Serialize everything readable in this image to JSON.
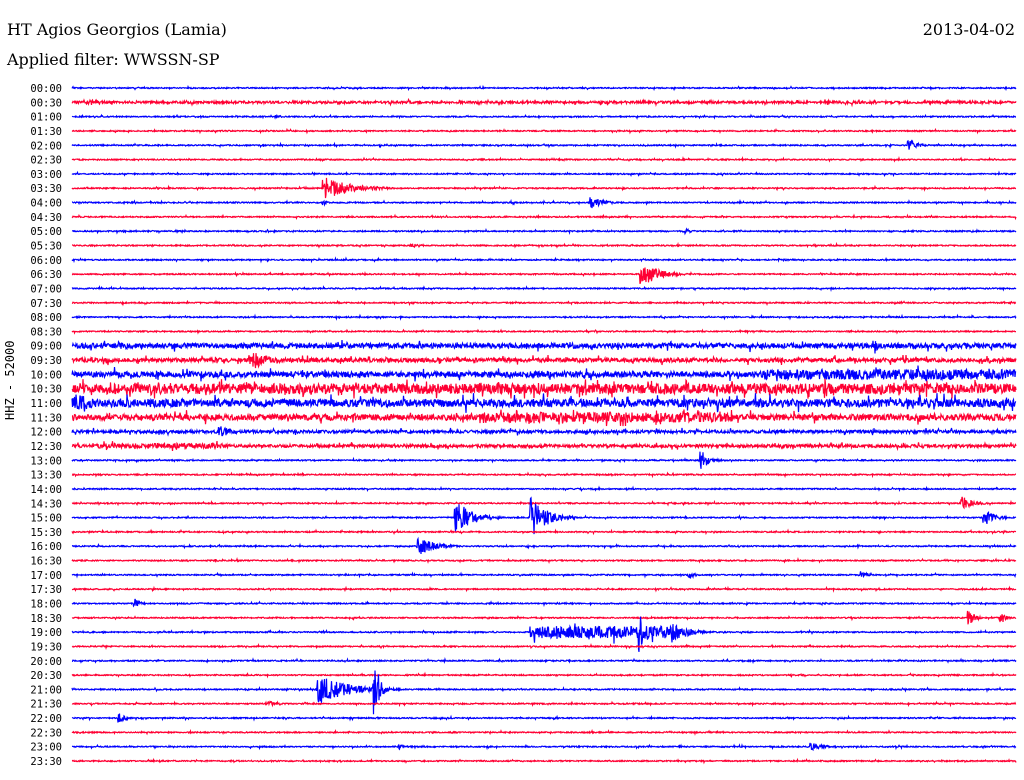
{
  "header": {
    "station": "HT Agios Georgios (Lamia)",
    "filter": "Applied filter: WWSSN-SP",
    "date": "2013-04-02"
  },
  "chart_data": {
    "type": "line",
    "title": "HT Agios Georgios (Lamia)",
    "ylabel": "HHZ - 52000",
    "xlabel": "",
    "minutes_per_row": 30,
    "colors": {
      "even": "#0000ff",
      "odd": "#ff0033"
    },
    "row_labels": [
      "00:00",
      "00:30",
      "01:00",
      "01:30",
      "02:00",
      "02:30",
      "03:00",
      "03:30",
      "04:00",
      "04:30",
      "05:00",
      "05:30",
      "06:00",
      "06:30",
      "07:00",
      "07:30",
      "08:00",
      "08:30",
      "09:00",
      "09:30",
      "10:00",
      "10:30",
      "11:00",
      "11:30",
      "12:00",
      "12:30",
      "13:00",
      "13:30",
      "14:00",
      "14:30",
      "15:00",
      "15:30",
      "16:00",
      "16:30",
      "17:00",
      "17:30",
      "18:00",
      "18:30",
      "19:00",
      "19:30",
      "20:00",
      "20:30",
      "21:00",
      "21:30",
      "22:00",
      "22:30",
      "23:00",
      "23:30"
    ],
    "noise_levels": {
      "18": 2.5,
      "19": 2,
      "20": 3,
      "21": 4,
      "22": 4,
      "23": 3,
      "24": 1.5,
      "25": 1.5,
      "1": 1.2
    },
    "events": [
      {
        "row": 1,
        "minute": 0.5,
        "amp": 3,
        "dur": 3
      },
      {
        "row": 2,
        "minute": 6.5,
        "amp": 2,
        "dur": 0.6
      },
      {
        "row": 4,
        "minute": 26.6,
        "amp": 6,
        "dur": 0.8
      },
      {
        "row": 7,
        "minute": 8.0,
        "amp": 12,
        "dur": 2.5
      },
      {
        "row": 8,
        "minute": 8.0,
        "amp": 3,
        "dur": 0.3
      },
      {
        "row": 8,
        "minute": 16.5,
        "amp": 6,
        "dur": 1.2
      },
      {
        "row": 10,
        "minute": 19.5,
        "amp": 3,
        "dur": 0.6
      },
      {
        "row": 11,
        "minute": 10.8,
        "amp": 2,
        "dur": 1.5
      },
      {
        "row": 12,
        "minute": 22.5,
        "amp": 2,
        "dur": 0.8
      },
      {
        "row": 13,
        "minute": 18.1,
        "amp": 14,
        "dur": 1.5
      },
      {
        "row": 18,
        "minute": 1.5,
        "amp": 4,
        "dur": 3
      },
      {
        "row": 18,
        "minute": 25.5,
        "amp": 10,
        "dur": 0.4
      },
      {
        "row": 19,
        "minute": 5.7,
        "amp": 10,
        "dur": 2
      },
      {
        "row": 19,
        "minute": 8.5,
        "amp": 4,
        "dur": 4
      },
      {
        "row": 20,
        "minute": 22,
        "amp": 10,
        "dur": 8
      },
      {
        "row": 21,
        "minute": 1,
        "amp": 10,
        "dur": 29
      },
      {
        "row": 22,
        "minute": 0,
        "amp": 12,
        "dur": 2
      },
      {
        "row": 23,
        "minute": 13,
        "amp": 10,
        "dur": 8
      },
      {
        "row": 24,
        "minute": 4.7,
        "amp": 6,
        "dur": 1.2
      },
      {
        "row": 25,
        "minute": 0.8,
        "amp": 5,
        "dur": 4
      },
      {
        "row": 26,
        "minute": 20,
        "amp": 10,
        "dur": 0.8
      },
      {
        "row": 29,
        "minute": 28.3,
        "amp": 8,
        "dur": 1
      },
      {
        "row": 30,
        "minute": 12.2,
        "amp": 18,
        "dur": 1.5
      },
      {
        "row": 30,
        "minute": 14.6,
        "amp": 20,
        "dur": 1.5
      },
      {
        "row": 30,
        "minute": 29,
        "amp": 8,
        "dur": 1
      },
      {
        "row": 32,
        "minute": 11,
        "amp": 10,
        "dur": 1.5
      },
      {
        "row": 34,
        "minute": 19.6,
        "amp": 5,
        "dur": 0.5
      },
      {
        "row": 34,
        "minute": 25.1,
        "amp": 4,
        "dur": 0.5
      },
      {
        "row": 36,
        "minute": 2,
        "amp": 5,
        "dur": 0.6
      },
      {
        "row": 37,
        "minute": 28.5,
        "amp": 10,
        "dur": 0.5
      },
      {
        "row": 37,
        "minute": 29.5,
        "amp": 8,
        "dur": 0.4
      },
      {
        "row": 38,
        "minute": 14.6,
        "amp": 12,
        "dur": 4.5
      },
      {
        "row": 38,
        "minute": 18,
        "amp": 25,
        "dur": 0.5
      },
      {
        "row": 38,
        "minute": 19,
        "amp": 12,
        "dur": 1.5
      },
      {
        "row": 42,
        "minute": 7.8,
        "amp": 16,
        "dur": 2.8
      },
      {
        "row": 42,
        "minute": 9.6,
        "amp": 35,
        "dur": 0.5
      },
      {
        "row": 43,
        "minute": 6.2,
        "amp": 3,
        "dur": 1
      },
      {
        "row": 44,
        "minute": 1.5,
        "amp": 5,
        "dur": 0.6
      },
      {
        "row": 46,
        "minute": 10.4,
        "amp": 3,
        "dur": 0.6
      },
      {
        "row": 46,
        "minute": 23.5,
        "amp": 4,
        "dur": 1.2
      }
    ]
  }
}
